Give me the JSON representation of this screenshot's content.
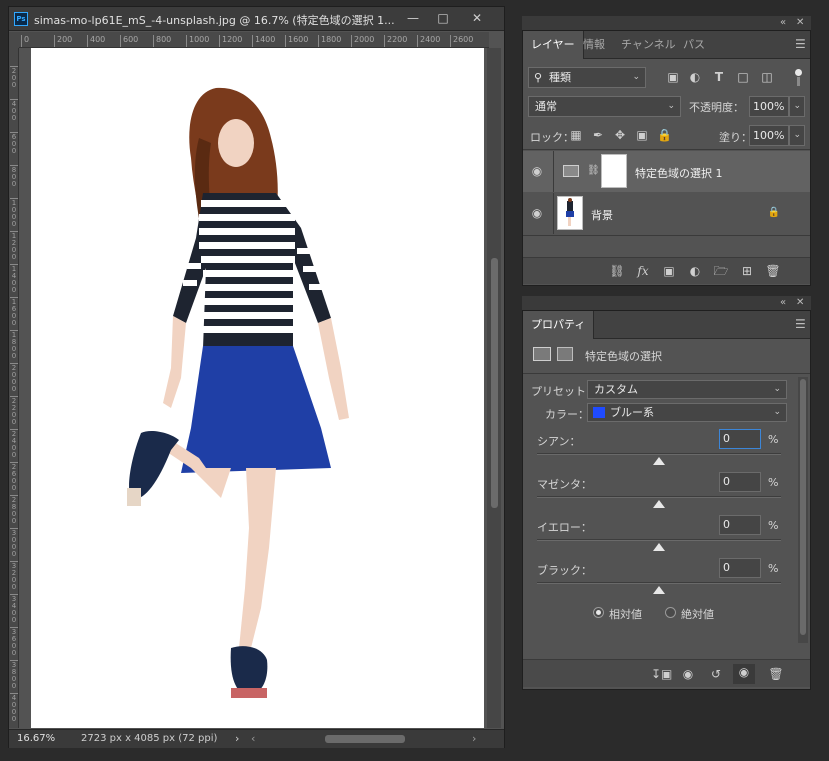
{
  "document": {
    "title": "simas-mo-lp61E_mS_-4-unsplash.jpg @ 16.7% (特定色域の選択 1...",
    "ps_logo": "Ps",
    "ruler_ticks": [
      "0",
      "200",
      "400",
      "600",
      "800",
      "1000",
      "1200",
      "1400",
      "1600",
      "1800",
      "2000",
      "2200",
      "2400",
      "2600"
    ],
    "vruler_ticks": [
      "200",
      "400",
      "600",
      "800",
      "1000",
      "1200",
      "1400",
      "1600",
      "1800",
      "2000",
      "2200",
      "2400",
      "2600",
      "2800",
      "3000",
      "3200",
      "3400",
      "3600",
      "3800",
      "4000"
    ],
    "zoom": "16.67%",
    "doc_size": "2723 px x 4085 px (72 ppi)"
  },
  "layers_panel": {
    "tabs": [
      "レイヤー",
      "情報",
      "チャンネル",
      "パス"
    ],
    "filter_kind": "種類",
    "blend_mode": "通常",
    "opacity_label": "不透明度：",
    "opacity_value": "100%",
    "lock_label": "ロック：",
    "fill_label": "塗り：",
    "fill_value": "100%",
    "layers": [
      {
        "name": "特定色域の選択 1",
        "selected": true
      },
      {
        "name": "背景",
        "locked": true
      }
    ]
  },
  "properties_panel": {
    "tab": "プロパティ",
    "header": "特定色域の選択",
    "preset_label": "プリセット：",
    "preset_value": "カスタム",
    "color_label": "カラー：",
    "color_value": "ブルー系",
    "color_swatch": "#1f4bff",
    "sliders": [
      {
        "label": "シアン：",
        "value": "0",
        "unit": "%",
        "position": 0.5
      },
      {
        "label": "マゼンタ：",
        "value": "0",
        "unit": "%",
        "position": 0.5
      },
      {
        "label": "イエロー：",
        "value": "0",
        "unit": "%",
        "position": 0.5
      },
      {
        "label": "ブラック：",
        "value": "0",
        "unit": "%",
        "position": 0.5
      }
    ],
    "relative_label": "相対値",
    "absolute_label": "絶対値",
    "mode_selected": "relative"
  },
  "colors": {
    "accent_focus": "#3c86d8",
    "skirt_blue": "#1f3fa6"
  }
}
